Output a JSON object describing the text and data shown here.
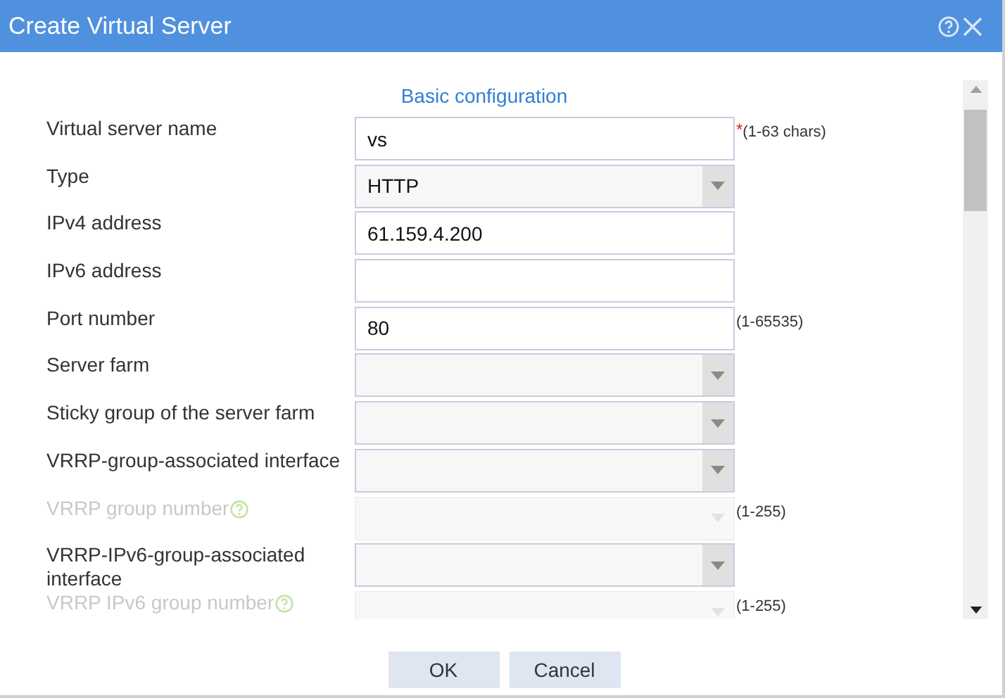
{
  "window": {
    "title": "Create Virtual Server"
  },
  "section_title": "Basic configuration",
  "fields": [
    {
      "label": "Virtual server name",
      "kind": "text",
      "value": "vs",
      "required_mark": "*",
      "hint": "(1-63 chars)",
      "disabled": false,
      "help": false
    },
    {
      "label": "Type",
      "kind": "select",
      "value": "HTTP",
      "disabled": false,
      "help": false
    },
    {
      "label": "IPv4 address",
      "kind": "text",
      "value": "61.159.4.200",
      "disabled": false,
      "help": false
    },
    {
      "label": "IPv6 address",
      "kind": "text",
      "disabled": false,
      "help": false
    },
    {
      "label": "Port number",
      "kind": "text",
      "value": "80",
      "hint": "(1-65535)",
      "disabled": false,
      "help": false
    },
    {
      "label": "Server farm",
      "kind": "select",
      "disabled": false,
      "help": false
    },
    {
      "label": "Sticky group of the server farm",
      "kind": "select",
      "disabled": false,
      "help": false
    },
    {
      "label": "VRRP-group-associated interface",
      "kind": "select",
      "disabled": false,
      "help": false
    },
    {
      "label": "VRRP group number",
      "kind": "select",
      "hint": "(1-255)",
      "disabled": true,
      "help": true
    },
    {
      "label": "VRRP-IPv6-group-associated interface",
      "kind": "select",
      "disabled": false,
      "help": false
    },
    {
      "label": "VRRP IPv6 group number",
      "kind": "select",
      "hint": "(1-255)",
      "disabled": true,
      "help": true
    }
  ],
  "buttons": [
    "OK",
    "Cancel"
  ]
}
